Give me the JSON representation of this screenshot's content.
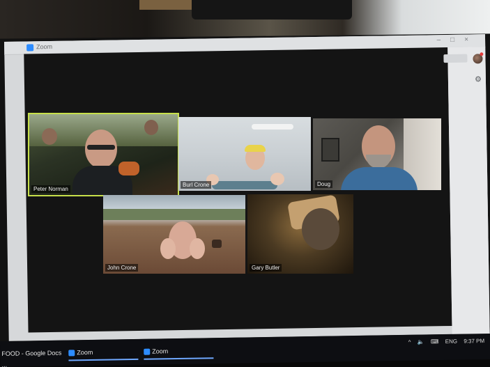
{
  "window": {
    "title": "Zoom"
  },
  "participants": [
    {
      "name": "Peter Norman",
      "active_speaker": true
    },
    {
      "name": "Burl Crone",
      "active_speaker": false
    },
    {
      "name": "Doug",
      "active_speaker": false
    },
    {
      "name": "John Crone",
      "active_speaker": false
    },
    {
      "name": "Gary Butler",
      "active_speaker": false
    }
  ],
  "taskbar": {
    "items": [
      {
        "label": "FOOD - Google Docs ..."
      },
      {
        "label": "Zoom"
      },
      {
        "label": "Zoom"
      }
    ],
    "tray": {
      "chevron": "^",
      "language": "ENG",
      "time": "9:37 PM"
    }
  },
  "colors": {
    "active_speaker_border": "#c7e04a",
    "zoom_blue": "#2d8cff"
  },
  "icons": [
    "zoom-app-icon",
    "gear-icon",
    "avatar",
    "volume-icon",
    "keyboard-icon"
  ]
}
